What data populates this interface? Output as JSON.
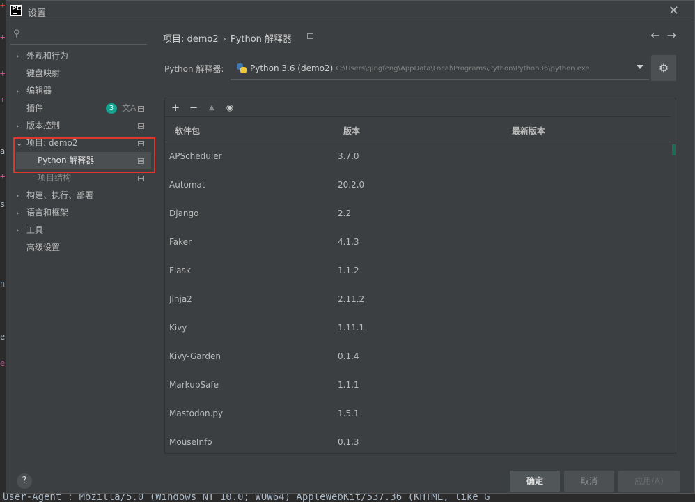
{
  "window": {
    "title": "设置",
    "logo": "PC"
  },
  "search": {
    "placeholder": ""
  },
  "sidebar": {
    "items": [
      {
        "label": "外观和行为",
        "has_arrow": true
      },
      {
        "label": "键盘映射",
        "has_arrow": false
      },
      {
        "label": "编辑器",
        "has_arrow": true
      },
      {
        "label": "插件",
        "badge": "3"
      },
      {
        "label": "版本控制",
        "has_arrow": true
      },
      {
        "label": "项目: demo2",
        "expanded": true
      },
      {
        "label": "Python 解释器",
        "selected": true
      },
      {
        "label": "项目结构"
      },
      {
        "label": "构建、执行、部署",
        "has_arrow": true
      },
      {
        "label": "语言和框架",
        "has_arrow": true
      },
      {
        "label": "工具",
        "has_arrow": true
      },
      {
        "label": "高级设置",
        "has_arrow": false
      }
    ]
  },
  "breadcrumb": {
    "project": "项目: demo2",
    "sep": "›",
    "page": "Python 解释器"
  },
  "interpreter": {
    "label": "Python 解释器:",
    "name": "Python 3.6 (demo2)",
    "path": "C:\\Users\\qingfeng\\AppData\\Local\\Programs\\Python\\Python36\\python.exe"
  },
  "toolbar": {
    "add": "+",
    "remove": "−",
    "up": "▲",
    "show": "👁"
  },
  "table": {
    "headers": {
      "package": "软件包",
      "version": "版本",
      "latest": "最新版本"
    },
    "rows": [
      {
        "package": "APScheduler",
        "version": "3.7.0",
        "latest": ""
      },
      {
        "package": "Automat",
        "version": "20.2.0",
        "latest": ""
      },
      {
        "package": "Django",
        "version": "2.2",
        "latest": ""
      },
      {
        "package": "Faker",
        "version": "4.1.3",
        "latest": ""
      },
      {
        "package": "Flask",
        "version": "1.1.2",
        "latest": ""
      },
      {
        "package": "Jinja2",
        "version": "2.11.2",
        "latest": ""
      },
      {
        "package": "Kivy",
        "version": "1.11.1",
        "latest": ""
      },
      {
        "package": "Kivy-Garden",
        "version": "0.1.4",
        "latest": ""
      },
      {
        "package": "MarkupSafe",
        "version": "1.1.1",
        "latest": ""
      },
      {
        "package": "Mastodon.py",
        "version": "1.5.1",
        "latest": ""
      },
      {
        "package": "MouseInfo",
        "version": "0.1.3",
        "latest": ""
      }
    ]
  },
  "footer": {
    "help": "?",
    "ok": "确定",
    "cancel": "取消",
    "apply": "应用(A)"
  },
  "background": {
    "bottom_text": "User-Agent : Mozilla/5.0 (Windows NT 10.0; WOW64) AppleWebKit/537.36 (KHTML, like G"
  },
  "colors": {
    "accent_badge": "#12a28e",
    "highlight_border": "#e0342c",
    "selection": "#4b4f52"
  }
}
